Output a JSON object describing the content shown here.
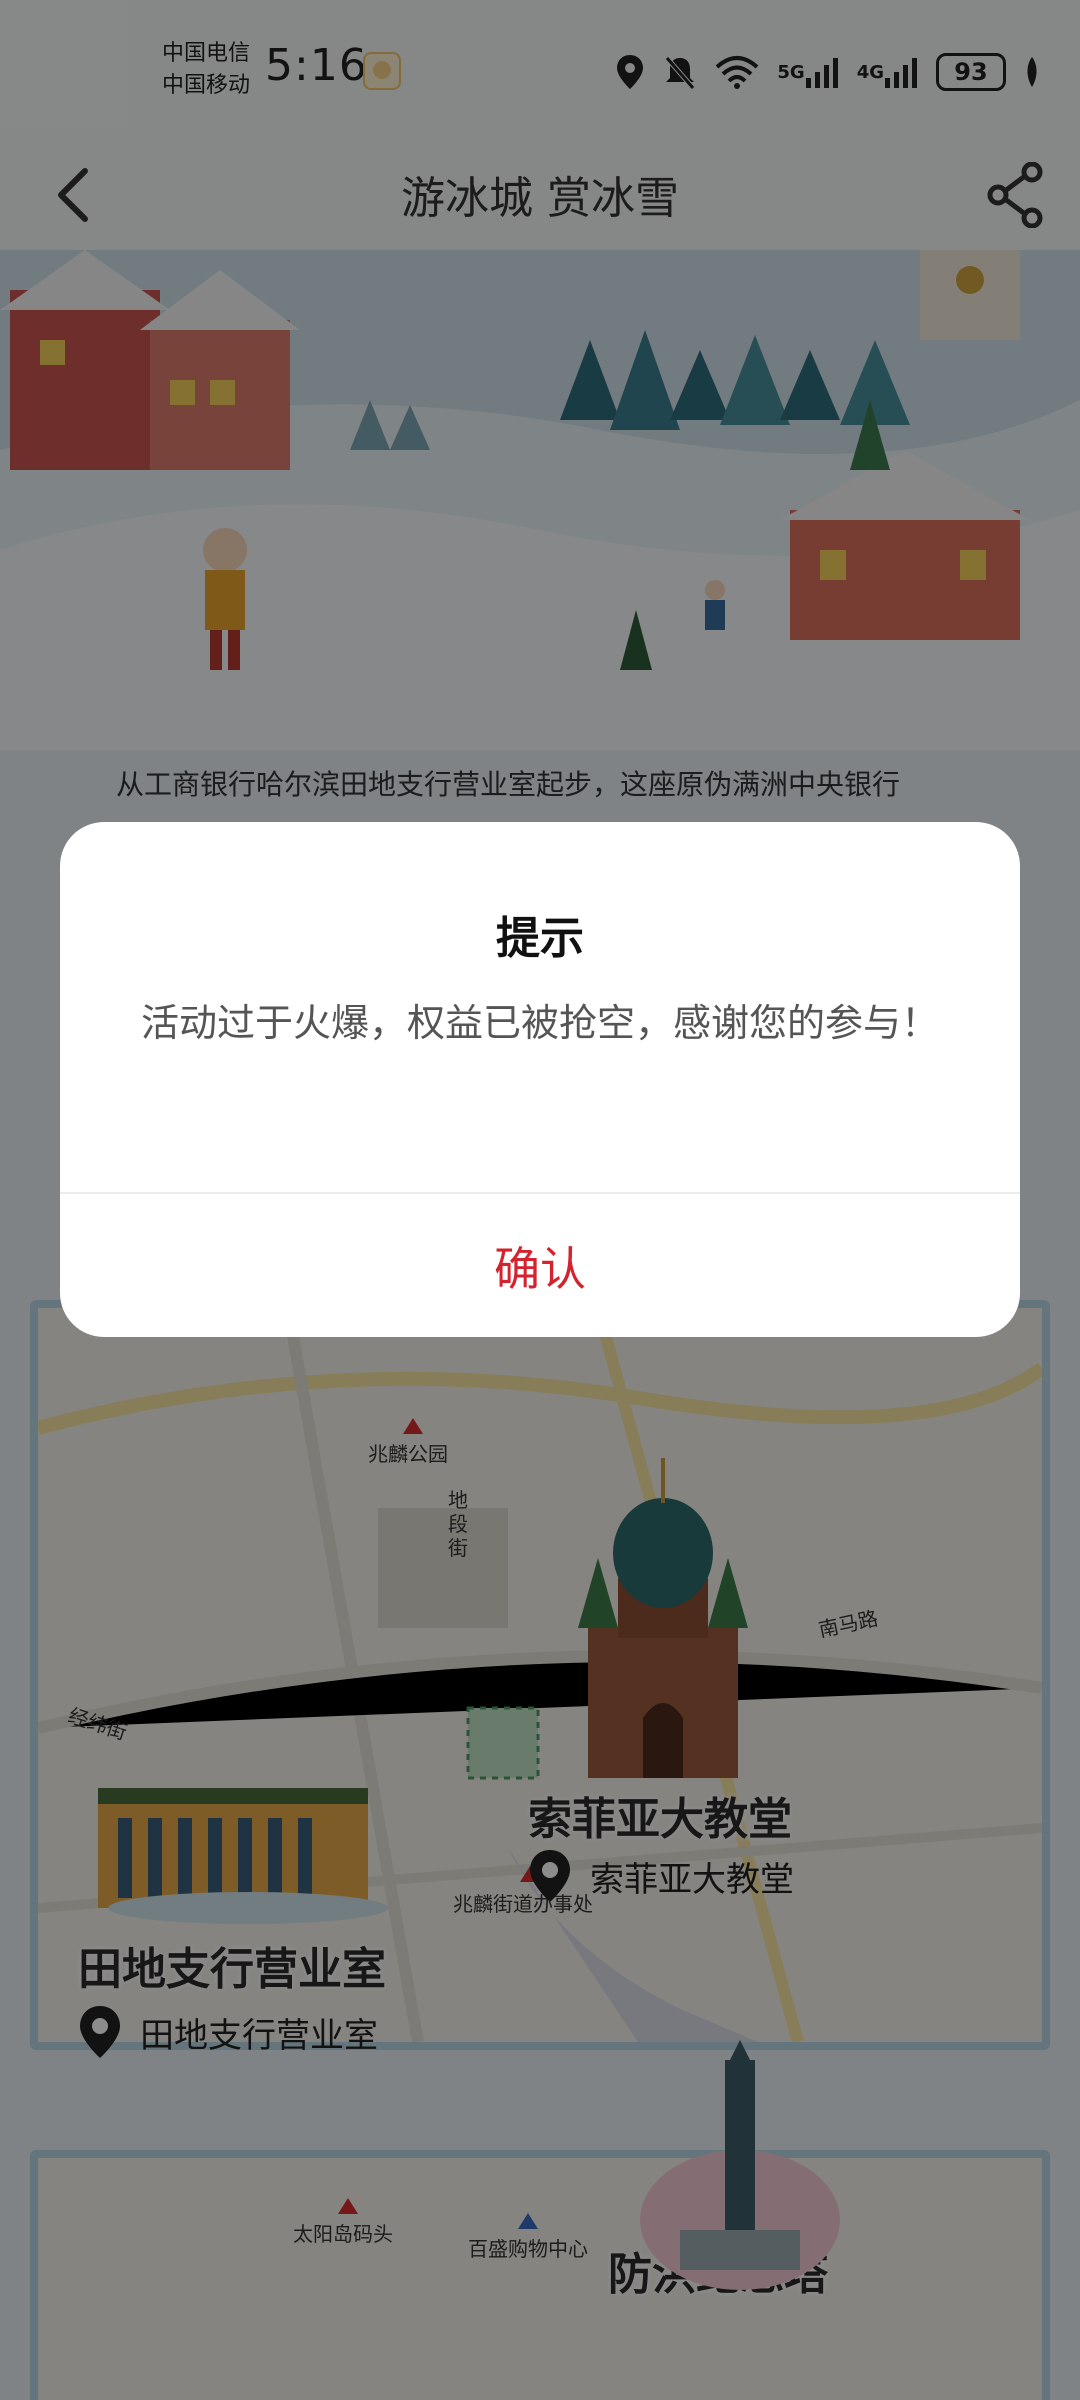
{
  "status_bar": {
    "carrier_1": "中国电信",
    "carrier_2": "中国移动",
    "time": "5:16",
    "network_1": "5G",
    "network_2": "4G",
    "battery": "93"
  },
  "nav": {
    "title": "游冰城 赏冰雪",
    "back_icon": "chevron-left-icon",
    "share_icon": "share-icon"
  },
  "content": {
    "intro_text": "从工商银行哈尔滨田地支行营业室起步，这座原伪满洲中央银行",
    "map": {
      "streets": [
        "兆麟公园",
        "地段街",
        "南马路",
        "经纬街",
        "兆麟街道办事处",
        "太阳岛码头",
        "百盛购物中心"
      ],
      "landmarks": [
        {
          "title": "索菲亚大教堂",
          "location": "索菲亚大教堂"
        },
        {
          "title": "田地支行营业室",
          "location": "田地支行营业室"
        },
        {
          "title": "防洪纪念塔"
        }
      ]
    }
  },
  "dialog": {
    "title": "提示",
    "message": "活动过于火爆，权益已被抢空，感谢您的参与！",
    "confirm_label": "确认"
  },
  "colors": {
    "accent": "#d5222f",
    "overlay": "rgba(0,0,0,0.45)"
  }
}
